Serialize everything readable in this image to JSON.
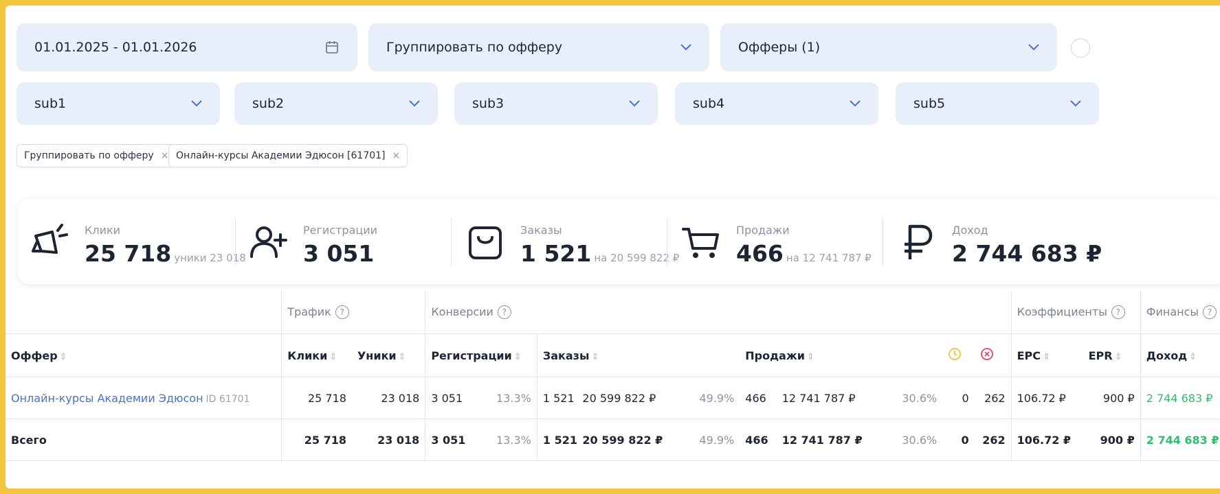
{
  "filters": {
    "date_range": "01.01.2025 - 01.01.2026",
    "group_by": "Группировать по офферу",
    "offers": "Офферы (1)",
    "subs": [
      "sub1",
      "sub2",
      "sub3",
      "sub4",
      "sub5"
    ]
  },
  "chips": [
    {
      "label": "Группировать по офферу"
    },
    {
      "label": "Онлайн-курсы Академии Эдюсон [61701]"
    }
  ],
  "stats": {
    "clicks": {
      "label": "Клики",
      "value": "25 718",
      "sub": "уники 23 018"
    },
    "registrations": {
      "label": "Регистрации",
      "value": "3 051"
    },
    "orders": {
      "label": "Заказы",
      "value": "1 521",
      "sub": "на 20 599 822 ₽"
    },
    "sales": {
      "label": "Продажи",
      "value": "466",
      "sub": "на 12 741 787 ₽"
    },
    "income": {
      "label": "Доход",
      "value": "2 744 683 ₽"
    }
  },
  "table": {
    "groups": {
      "traffic": "Трафик",
      "conversions": "Конверсии",
      "ratios": "Коэффициенты",
      "finance": "Финансы"
    },
    "headers": {
      "offer": "Оффер",
      "clicks": "Клики",
      "uniques": "Уники",
      "registrations": "Регистрации",
      "orders": "Заказы",
      "sales": "Продажи",
      "epc": "EPC",
      "epr": "EPR",
      "income": "Доход"
    },
    "row": {
      "offer": "Онлайн-курсы Академии Эдюсон",
      "offer_id": "ID 61701",
      "clicks": "25 718",
      "uniques": "23 018",
      "registrations": "3 051",
      "reg_pct": "13.3%",
      "orders": "1 521",
      "orders_sum": "20 599 822 ₽",
      "orders_pct": "49.9%",
      "sales": "466",
      "sales_sum": "12 741 787 ₽",
      "sales_pct": "30.6%",
      "pending": "0",
      "rejected": "262",
      "epc": "106.72 ₽",
      "epr": "900 ₽",
      "income": "2 744 683 ₽"
    },
    "total": {
      "label": "Всего",
      "clicks": "25 718",
      "uniques": "23 018",
      "registrations": "3 051",
      "reg_pct": "13.3%",
      "orders": "1 521",
      "orders_sum": "20 599 822 ₽",
      "orders_pct": "49.9%",
      "sales": "466",
      "sales_sum": "12 741 787 ₽",
      "sales_pct": "30.6%",
      "pending": "0",
      "rejected": "262",
      "epc": "106.72 ₽",
      "epr": "900 ₽",
      "income": "2 744 683 ₽"
    }
  },
  "colors": {
    "frame": "#f4c53e",
    "field_bg": "#e9eefb",
    "link": "#4a72c9",
    "income_green": "#2dbf6c",
    "pending_icon": "#f2c23a",
    "rejected_icon": "#e8455a"
  },
  "icons": [
    "calendar-icon",
    "chevron-down-icon",
    "megaphone-icon",
    "user-plus-icon",
    "shopping-bag-icon",
    "cart-icon",
    "ruble-icon",
    "help-icon",
    "clock-icon",
    "x-circle-icon",
    "sort-icon"
  ]
}
